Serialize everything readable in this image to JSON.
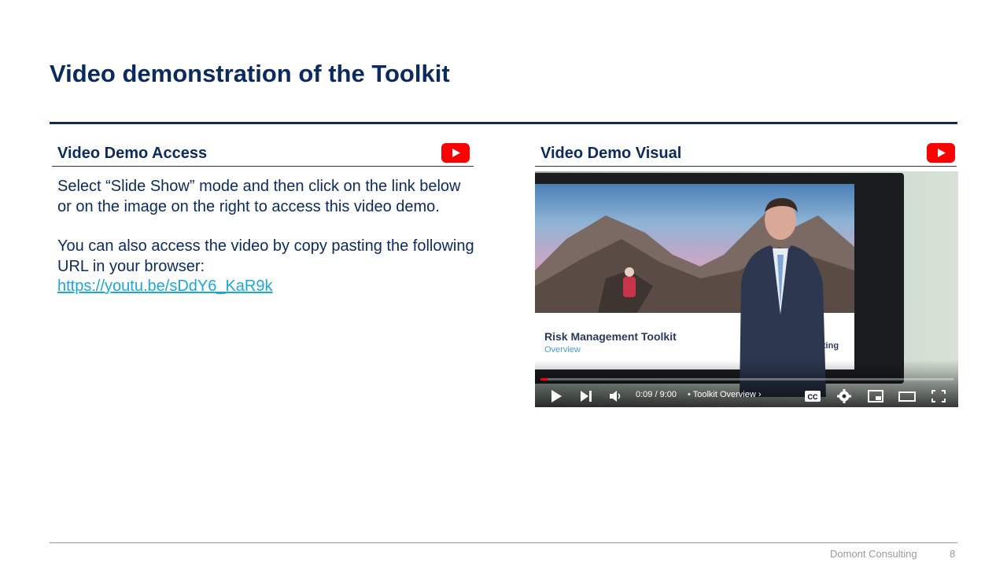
{
  "slide": {
    "title": "Video demonstration of the Toolkit",
    "footer_brand": "Domont Consulting",
    "page_number": "8"
  },
  "left_panel": {
    "heading": "Video Demo Access",
    "icon": "youtube-icon",
    "paragraph1": "Select “Slide Show” mode and then click on the link below or on the image on the right to access this video demo.",
    "paragraph2": "You can also access the video by copy pasting the following URL in your browser:",
    "url": "https://youtu.be/sDdY6_KaR9k"
  },
  "right_panel": {
    "heading": "Video Demo Visual",
    "icon": "youtube-icon"
  },
  "video": {
    "slide_title": "Risk Management Toolkit",
    "slide_subtitle": "Overview",
    "slide_brand": "sulting",
    "time": "0:09 / 9:00",
    "chapter": "• Toolkit Overview ›",
    "progress_fraction": 0.017
  },
  "colors": {
    "title": "#0b2a5e",
    "link": "#1aa7d9",
    "youtube_red": "#ff0000"
  }
}
